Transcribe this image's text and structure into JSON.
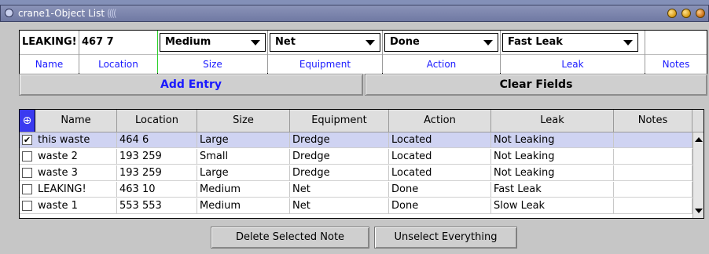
{
  "window": {
    "title": "crane1-Object List",
    "title_decoration": "(((("
  },
  "form": {
    "name": {
      "value": "LEAKING!",
      "label": "Name"
    },
    "location": {
      "value": "467 7",
      "label": "Location"
    },
    "size": {
      "value": "Medium",
      "label": "Size"
    },
    "equipment": {
      "value": "Net",
      "label": "Equipment"
    },
    "action": {
      "value": "Done",
      "label": "Action"
    },
    "leak": {
      "value": "Fast Leak",
      "label": "Leak"
    },
    "notes": {
      "value": "",
      "label": "Notes"
    }
  },
  "buttons": {
    "add_entry": "Add Entry",
    "clear_fields": "Clear Fields",
    "delete_selected": "Delete Selected Note",
    "unselect_everything": "Unselect Everything"
  },
  "table": {
    "corner_icon": "crosshair-icon",
    "columns": [
      "Name",
      "Location",
      "Size",
      "Equipment",
      "Action",
      "Leak",
      "Notes"
    ],
    "rows": [
      {
        "checked": true,
        "selected": true,
        "cells": [
          "this waste",
          "464 6",
          "Large",
          "Dredge",
          "Located",
          "Not Leaking",
          ""
        ]
      },
      {
        "checked": false,
        "selected": false,
        "cells": [
          "waste 2",
          "193 259",
          "Small",
          "Dredge",
          "Located",
          "Not Leaking",
          ""
        ]
      },
      {
        "checked": false,
        "selected": false,
        "cells": [
          "waste 3",
          "193 259",
          "Large",
          "Dredge",
          "Located",
          "Not Leaking",
          ""
        ]
      },
      {
        "checked": false,
        "selected": false,
        "cells": [
          "LEAKING!",
          "463 10",
          "Medium",
          "Net",
          "Done",
          "Fast Leak",
          ""
        ]
      },
      {
        "checked": false,
        "selected": false,
        "cells": [
          "waste 1",
          "553 553",
          "Medium",
          "Net",
          "Done",
          "Slow Leak",
          ""
        ]
      }
    ]
  },
  "colors": {
    "label_blue": "#1a1aff",
    "title_bar": "#7c85ad",
    "selected_row": "#cfd3f2",
    "panel_gray": "#c6c6c6"
  }
}
